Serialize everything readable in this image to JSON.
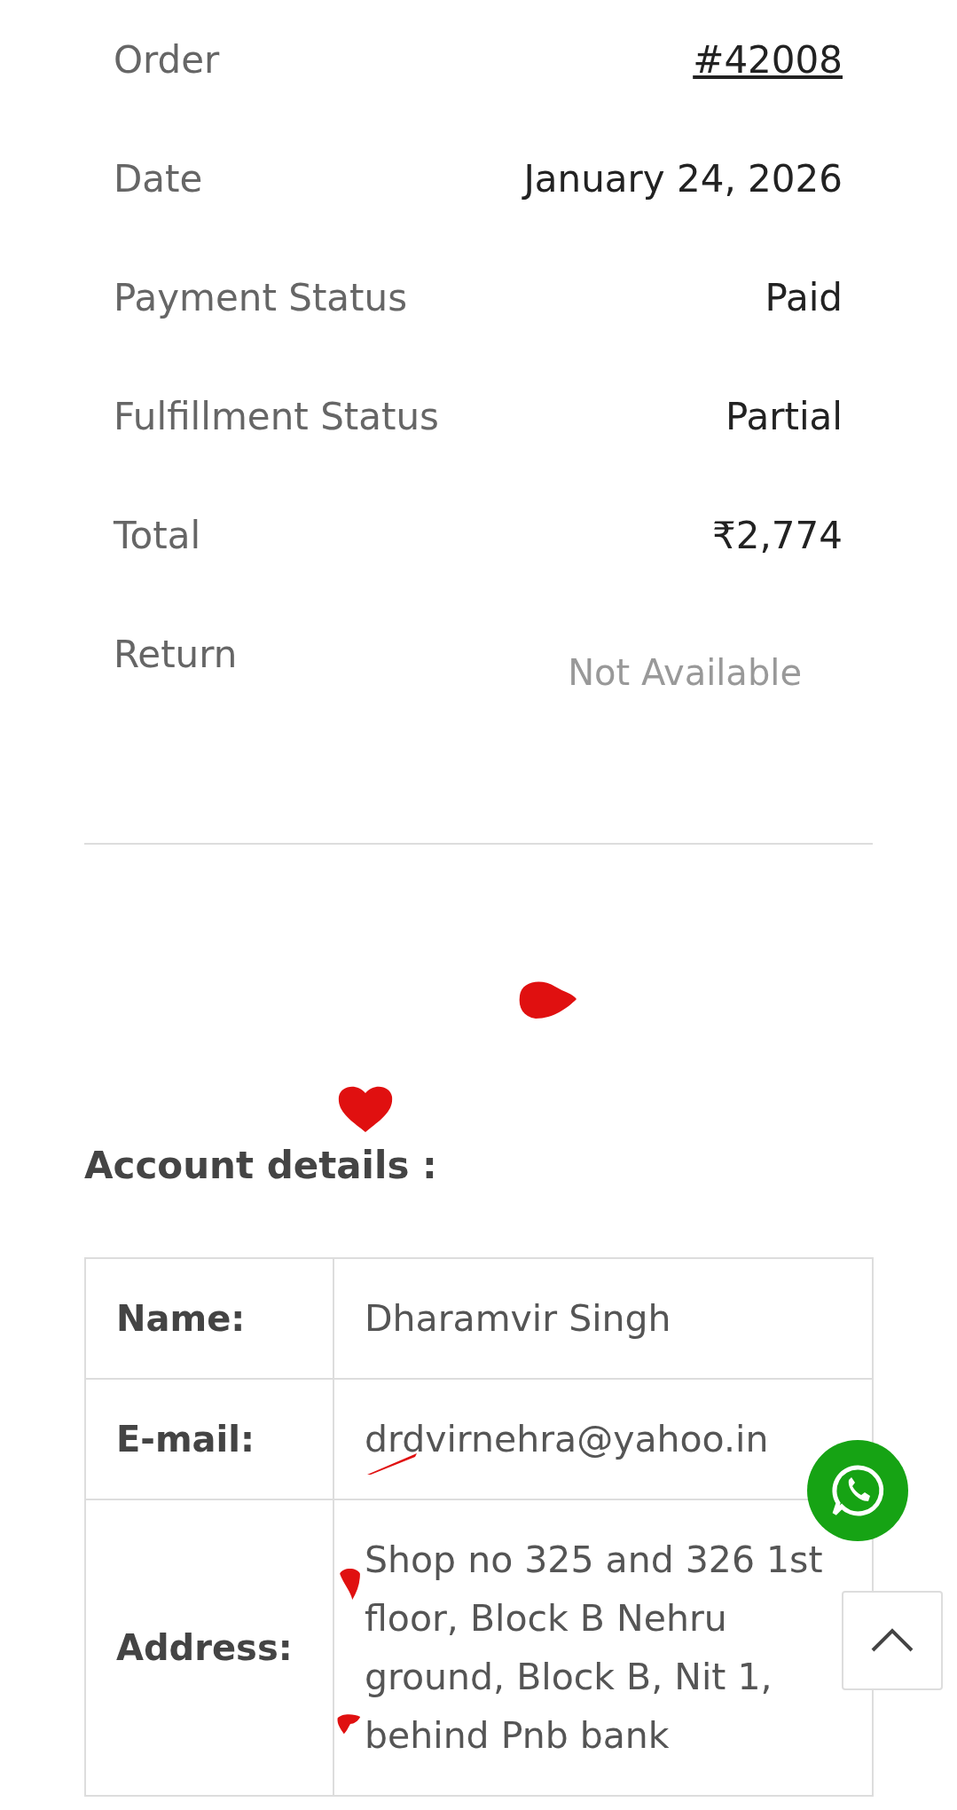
{
  "order_summary": [
    {
      "label": "Order",
      "value": "#42008",
      "kind": "link"
    },
    {
      "label": "Date",
      "value": "January 24, 2026",
      "kind": "text"
    },
    {
      "label": "Payment Status",
      "value": "Paid",
      "kind": "text"
    },
    {
      "label": "Fulfillment Status",
      "value": "Partial",
      "kind": "text"
    },
    {
      "label": "Total",
      "value": "₹2,774",
      "kind": "text"
    },
    {
      "label": "Return",
      "value": "Not Available",
      "kind": "muted"
    }
  ],
  "account": {
    "heading": "Account details :",
    "rows": [
      {
        "label": "Name:",
        "value": "Dharamvir Singh"
      },
      {
        "label": "E-mail:",
        "value": "drdvirnehra@yahoo.in"
      },
      {
        "label": "Address:",
        "value": "Shop no 325 and 326 1st floor, Block B Nehru ground, Block B, Nit 1, behind Pnb bank"
      }
    ]
  }
}
